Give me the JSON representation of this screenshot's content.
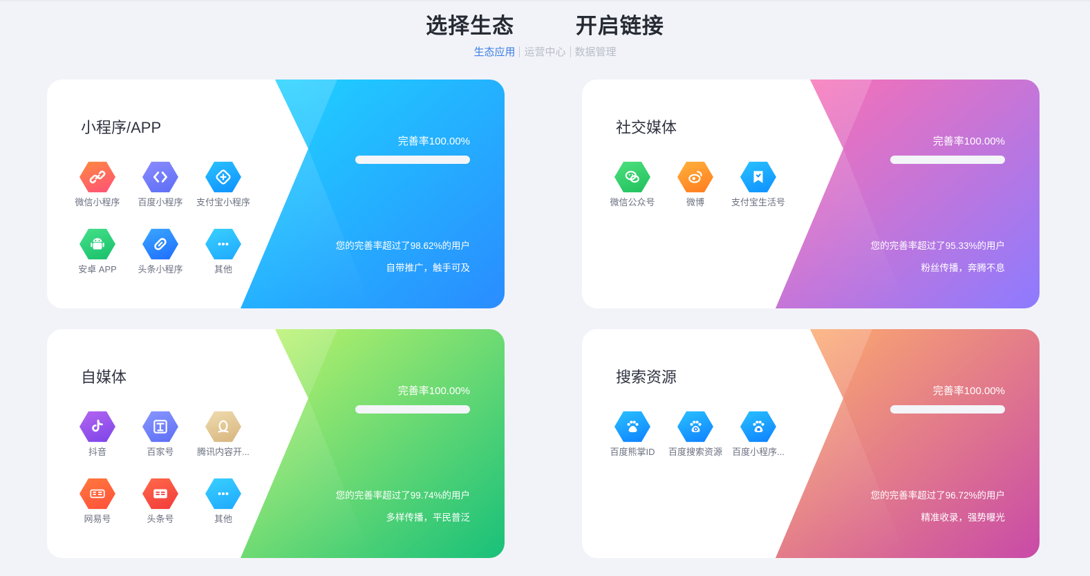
{
  "header": {
    "title": "选择生态   开启链接",
    "tabs": [
      {
        "label": "生态应用",
        "active": true
      },
      {
        "label": "运营中心",
        "active": false
      },
      {
        "label": "数据管理",
        "active": false
      }
    ]
  },
  "cards": [
    {
      "title": "小程序/APP",
      "rate": "完善率100.00%",
      "progress": 1.0,
      "beat": "您的完善率超过了98.62%的用户",
      "slogan": "自带推广，触手可及",
      "colors": {
        "start": "#1ed6ff",
        "end": "#2a8cff"
      },
      "apps": [
        {
          "label": "微信小程序",
          "icon": "link-icon",
          "color1": "#ff8a3d",
          "color2": "#ff4f7a"
        },
        {
          "label": "百度小程序",
          "icon": "code-icon",
          "color1": "#8c8cff",
          "color2": "#5b6df5"
        },
        {
          "label": "支付宝小程序",
          "icon": "cube-icon",
          "color1": "#2ac2ff",
          "color2": "#0d8fff"
        },
        {
          "label": "安卓 APP",
          "icon": "android-icon",
          "color1": "#46e08a",
          "color2": "#17bf6a"
        },
        {
          "label": "头条小程序",
          "icon": "chain-icon",
          "color1": "#3aa8ff",
          "color2": "#1f6bff"
        },
        {
          "label": "其他",
          "icon": "more-icon",
          "color1": "#3ad1ff",
          "color2": "#1ea8ff"
        }
      ]
    },
    {
      "title": "社交媒体",
      "rate": "完善率100.00%",
      "progress": 1.0,
      "beat": "您的完善率超过了95.33%的用户",
      "slogan": "粉丝传播，奔腾不息",
      "colors": {
        "start": "#ff6fb0",
        "end": "#8d7bff"
      },
      "apps": [
        {
          "label": "微信公众号",
          "icon": "wechat-icon",
          "color1": "#4fe07f",
          "color2": "#1fbf5c"
        },
        {
          "label": "微博",
          "icon": "weibo-icon",
          "color1": "#ffb23d",
          "color2": "#ff7a1e"
        },
        {
          "label": "支付宝生活号",
          "icon": "bookmark-icon",
          "color1": "#2ac2ff",
          "color2": "#0d8fff"
        }
      ]
    },
    {
      "title": "自媒体",
      "rate": "完善率100.00%",
      "progress": 1.0,
      "beat": "您的完善率超过了99.74%的用户",
      "slogan": "多样传播，平民普泛",
      "colors": {
        "start": "#c4f56b",
        "end": "#18c07a"
      },
      "apps": [
        {
          "label": "抖音",
          "icon": "tiktok-icon",
          "color1": "#b565f0",
          "color2": "#7b44e8"
        },
        {
          "label": "百家号",
          "icon": "baijia-icon",
          "color1": "#8a98ff",
          "color2": "#5b6df5"
        },
        {
          "label": "腾讯内容开...",
          "icon": "penguin-icon",
          "color1": "#f0dcb0",
          "color2": "#d6b47c"
        },
        {
          "label": "网易号",
          "icon": "netease-icon",
          "color1": "#ff7a3d",
          "color2": "#ff4f3a"
        },
        {
          "label": "头条号",
          "icon": "toutiao-icon",
          "color1": "#ff6a4a",
          "color2": "#f23a3a"
        },
        {
          "label": "其他",
          "icon": "more-icon",
          "color1": "#3ad1ff",
          "color2": "#1ea8ff"
        }
      ]
    },
    {
      "title": "搜索资源",
      "rate": "完善率100.00%",
      "progress": 1.0,
      "beat": "您的完善率超过了96.72%的用户",
      "slogan": "精准收录，强势曝光",
      "colors": {
        "start": "#ffb06a",
        "end": "#c84aa8"
      },
      "apps": [
        {
          "label": "百度熊掌ID",
          "icon": "paw-icon",
          "color1": "#2ac2ff",
          "color2": "#0d7fff"
        },
        {
          "label": "百度搜索资源",
          "icon": "paw-search-icon",
          "color1": "#2ac2ff",
          "color2": "#0d7fff"
        },
        {
          "label": "百度小程序...",
          "icon": "paw-app-icon",
          "color1": "#2ac2ff",
          "color2": "#0d7fff"
        }
      ]
    }
  ]
}
